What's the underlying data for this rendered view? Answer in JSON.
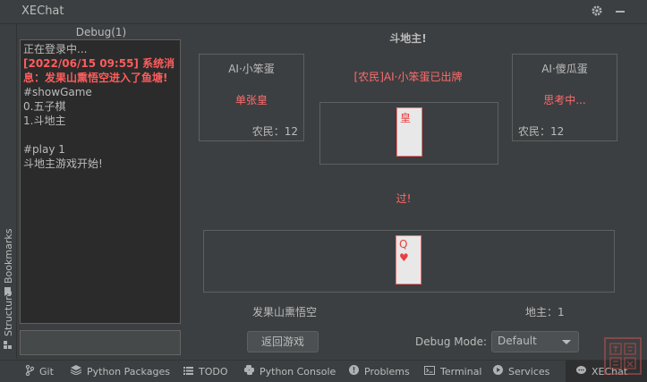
{
  "window": {
    "title": "XEChat"
  },
  "left_tabs": {
    "bookmarks": "Bookmarks",
    "structure": "Structure"
  },
  "debug": {
    "title": "Debug(1)",
    "log": [
      {
        "text": "正在登录中...",
        "style": "normal"
      },
      {
        "text": "[2022/06/15 09:55] 系统消息：发果山熏悟空进入了鱼塘!",
        "style": "red"
      },
      {
        "text": "#showGame",
        "style": "normal"
      },
      {
        "text": "0.五子棋",
        "style": "normal"
      },
      {
        "text": "1.斗地主",
        "style": "normal"
      },
      {
        "text": "",
        "style": "normal"
      },
      {
        "text": "#play 1",
        "style": "normal"
      },
      {
        "text": "斗地主游戏开始!",
        "style": "normal"
      }
    ],
    "input_value": ""
  },
  "game": {
    "title": "斗地主!",
    "left_player": {
      "name": "AI·小笨蛋",
      "status": "单张皇",
      "count": "农民：12"
    },
    "right_player": {
      "name": "AI·傻瓜蛋",
      "status": "思考中...",
      "count": "农民：12"
    },
    "center_notice": "[农民]AI·小笨蛋已出牌",
    "played_card": {
      "rank": "皇",
      "suit": ""
    },
    "pass_text": "过!",
    "hand_card": {
      "rank": "Q",
      "suit": "♥"
    },
    "self_name": "发果山熏悟空",
    "self_count": "地主：1",
    "back_button": "返回游戏",
    "debug_mode_label": "Debug Mode:",
    "debug_mode_value": "Default"
  },
  "bottom_tabs": [
    {
      "label": "Git",
      "icon": "git-branch-icon"
    },
    {
      "label": "Python Packages",
      "icon": "layers-icon"
    },
    {
      "label": "TODO",
      "icon": "list-icon"
    },
    {
      "label": "Python Console",
      "icon": "python-icon"
    },
    {
      "label": "Problems",
      "icon": "info-circle-icon"
    },
    {
      "label": "Terminal",
      "icon": "terminal-icon"
    },
    {
      "label": "Services",
      "icon": "play-circle-icon"
    },
    {
      "label": "XEChat",
      "icon": "chat-icon",
      "active": true
    }
  ],
  "colors": {
    "accent_red": "#ff6b6b",
    "background": "#3c3f41",
    "panel": "#2b2b2b"
  }
}
